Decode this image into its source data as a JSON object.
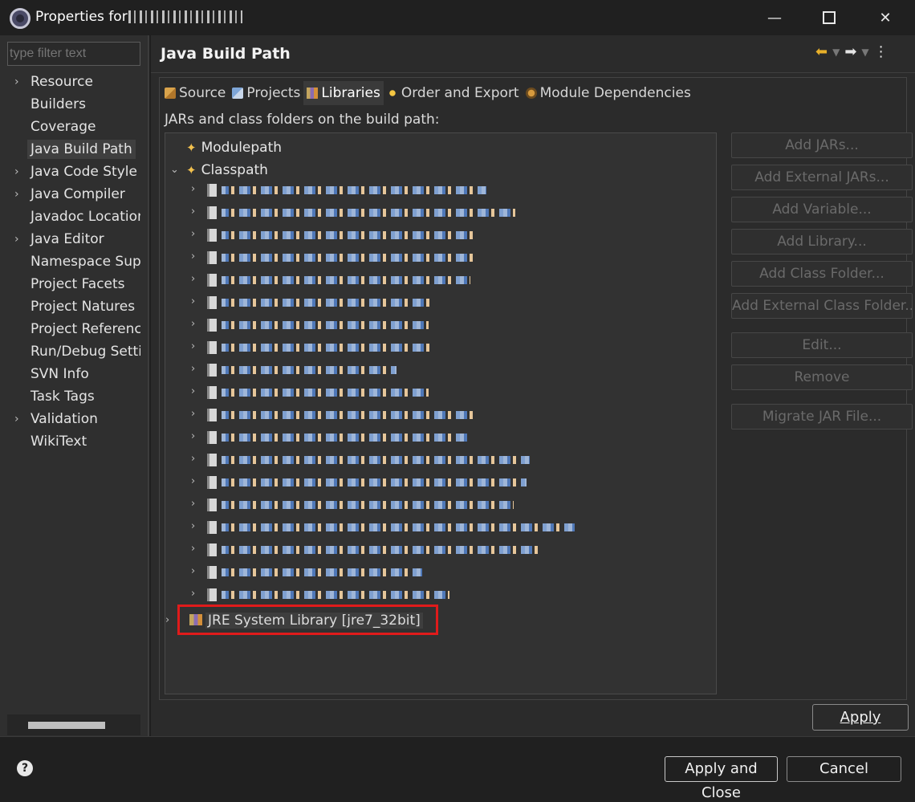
{
  "window": {
    "title": "Properties for",
    "title_obscured": true,
    "min_glyph": "—",
    "close_glyph": "✕"
  },
  "sidebar": {
    "filter_placeholder": "type filter text",
    "items": [
      {
        "label": "Resource",
        "expandable": true
      },
      {
        "label": "Builders",
        "expandable": false
      },
      {
        "label": "Coverage",
        "expandable": false
      },
      {
        "label": "Java Build Path",
        "expandable": false,
        "selected": true
      },
      {
        "label": "Java Code Style",
        "expandable": true
      },
      {
        "label": "Java Compiler",
        "expandable": true
      },
      {
        "label": "Javadoc Location",
        "expandable": false
      },
      {
        "label": "Java Editor",
        "expandable": true
      },
      {
        "label": "Namespace Support",
        "expandable": false
      },
      {
        "label": "Project Facets",
        "expandable": false
      },
      {
        "label": "Project Natures",
        "expandable": false
      },
      {
        "label": "Project References",
        "expandable": false
      },
      {
        "label": "Run/Debug Settings",
        "expandable": false
      },
      {
        "label": "SVN Info",
        "expandable": false
      },
      {
        "label": "Task Tags",
        "expandable": false
      },
      {
        "label": "Validation",
        "expandable": true
      },
      {
        "label": "WikiText",
        "expandable": false
      }
    ]
  },
  "header": {
    "title": "Java Build Path",
    "nav": {
      "back": "⬅",
      "dropdown": "▼",
      "forward": "➡",
      "menu": "⋮"
    }
  },
  "tabs": [
    {
      "label": "Source",
      "icon": "source-folder-icon",
      "active": false
    },
    {
      "label": "Projects",
      "icon": "projects-icon",
      "active": false
    },
    {
      "label": "Libraries",
      "icon": "libraries-icon",
      "active": true
    },
    {
      "label": "Order and Export",
      "icon": "order-export-icon",
      "active": false
    },
    {
      "label": "Module Dependencies",
      "icon": "module-dependencies-icon",
      "active": false
    }
  ],
  "libraries": {
    "section_label": "JARs and class folders on the build path:",
    "modulepath_label": "Modulepath",
    "classpath_label": "Classpath",
    "jar_entries_obscured_count": 19,
    "jre_label": "JRE System Library [jre7_32bit]",
    "highlight_color": "#e01b1b"
  },
  "buttons": {
    "add_jars": "Add JARs...",
    "add_external_jars": "Add External JARs...",
    "add_variable": "Add Variable...",
    "add_library": "Add Library...",
    "add_class_folder": "Add Class Folder...",
    "add_external_class_folder": "Add External Class Folder...",
    "edit": "Edit...",
    "remove": "Remove",
    "migrate_jar": "Migrate JAR File...",
    "apply": "Apply"
  },
  "footer": {
    "help": "?",
    "apply_and_close": "Apply and Close",
    "cancel": "Cancel"
  }
}
